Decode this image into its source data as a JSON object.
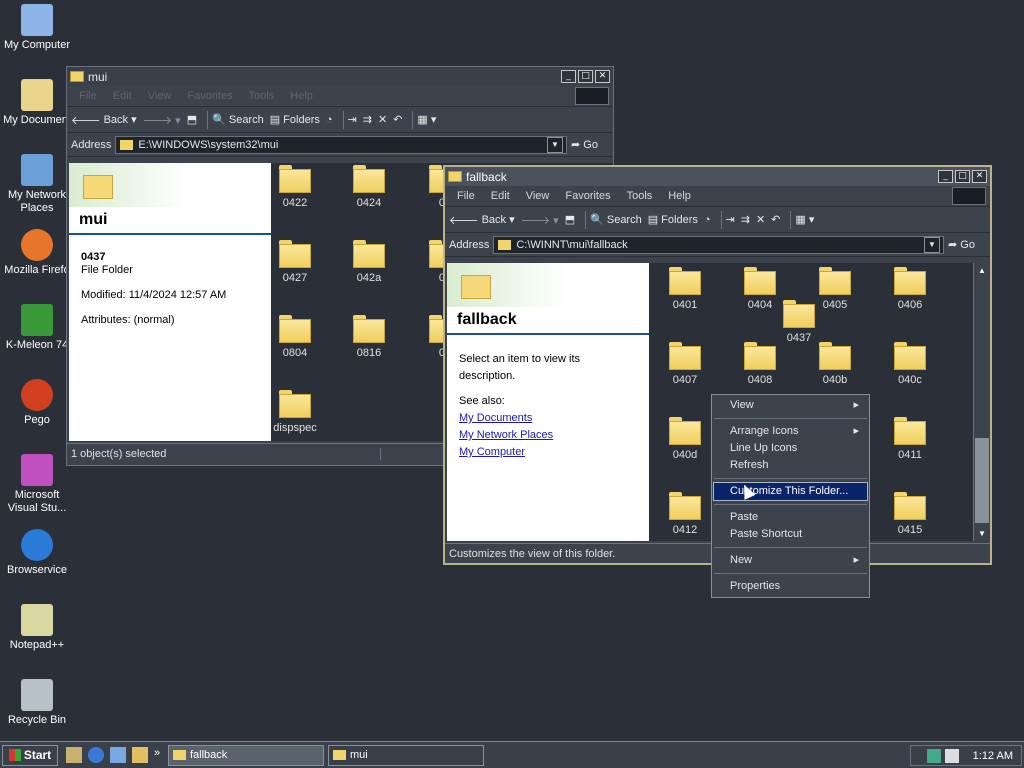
{
  "desktop": {
    "icons": [
      {
        "label": "My Computer",
        "name": "my-computer-icon"
      },
      {
        "label": "My Document",
        "name": "my-documents-icon"
      },
      {
        "label": "My Network Places",
        "name": "my-network-places-icon"
      },
      {
        "label": "Mozilla Firefo",
        "name": "firefox-icon"
      },
      {
        "label": "K-Meleon 74",
        "name": "kmeleon-icon"
      },
      {
        "label": "Pego",
        "name": "pego-icon"
      },
      {
        "label": "Microsoft Visual Stu...",
        "name": "visual-studio-icon"
      },
      {
        "label": "Browservice",
        "name": "browservice-icon"
      },
      {
        "label": "Notepad++",
        "name": "notepadpp-icon"
      },
      {
        "label": "Recycle Bin",
        "name": "recycle-bin-icon"
      }
    ]
  },
  "mui_window": {
    "title": "mui",
    "menu": [
      "File",
      "Edit",
      "View",
      "Favorites",
      "Tools",
      "Help"
    ],
    "toolbar": {
      "back": "Back",
      "search": "Search",
      "folders": "Folders"
    },
    "address_label": "Address",
    "address_value": "E:\\WINDOWS\\system32\\mui",
    "go": "Go",
    "webview": {
      "folder_name": "mui",
      "selected_name": "0437",
      "selected_type": "File Folder",
      "modified": "Modified: 11/4/2024 12:57 AM",
      "attributes": "Attributes: (normal)"
    },
    "folders": [
      "0422",
      "0424",
      "04",
      "0427",
      "042a",
      "04",
      "0804",
      "0816",
      "08",
      "dispspec"
    ],
    "status": "1 object(s) selected"
  },
  "fallback_window": {
    "title": "fallback",
    "menu": [
      "File",
      "Edit",
      "View",
      "Favorites",
      "Tools",
      "Help"
    ],
    "toolbar": {
      "back": "Back",
      "search": "Search",
      "folders": "Folders"
    },
    "address_label": "Address",
    "address_value": "C:\\WINNT\\mui\\fallback",
    "go": "Go",
    "webview": {
      "folder_name": "fallback",
      "description": "Select an item to view its description.",
      "see_also": "See also:",
      "links": [
        "My Documents",
        "My Network Places",
        "My Computer"
      ]
    },
    "folders": [
      "0401",
      "0404",
      "0405",
      "0406",
      "0437",
      "0407",
      "0408",
      "040b",
      "040c",
      "040d",
      "0411",
      "0412",
      "0415"
    ],
    "status": "Customizes the view of this folder."
  },
  "context_menu": {
    "items": [
      {
        "label": "View",
        "submenu": true
      },
      {
        "sep": true
      },
      {
        "label": "Arrange Icons",
        "submenu": true
      },
      {
        "label": "Line Up Icons"
      },
      {
        "label": "Refresh"
      },
      {
        "sep": true
      },
      {
        "label": "Customize This Folder...",
        "selected": true
      },
      {
        "sep": true
      },
      {
        "label": "Paste"
      },
      {
        "label": "Paste Shortcut"
      },
      {
        "sep": true
      },
      {
        "label": "New",
        "submenu": true
      },
      {
        "sep": true
      },
      {
        "label": "Properties"
      }
    ]
  },
  "taskbar": {
    "start": "Start",
    "tasks": [
      "fallback",
      "mui"
    ],
    "clock": "1:12 AM"
  },
  "colors": {
    "selection": "#0a246a",
    "link": "#1a1ab8",
    "folder": "#f5d978"
  }
}
